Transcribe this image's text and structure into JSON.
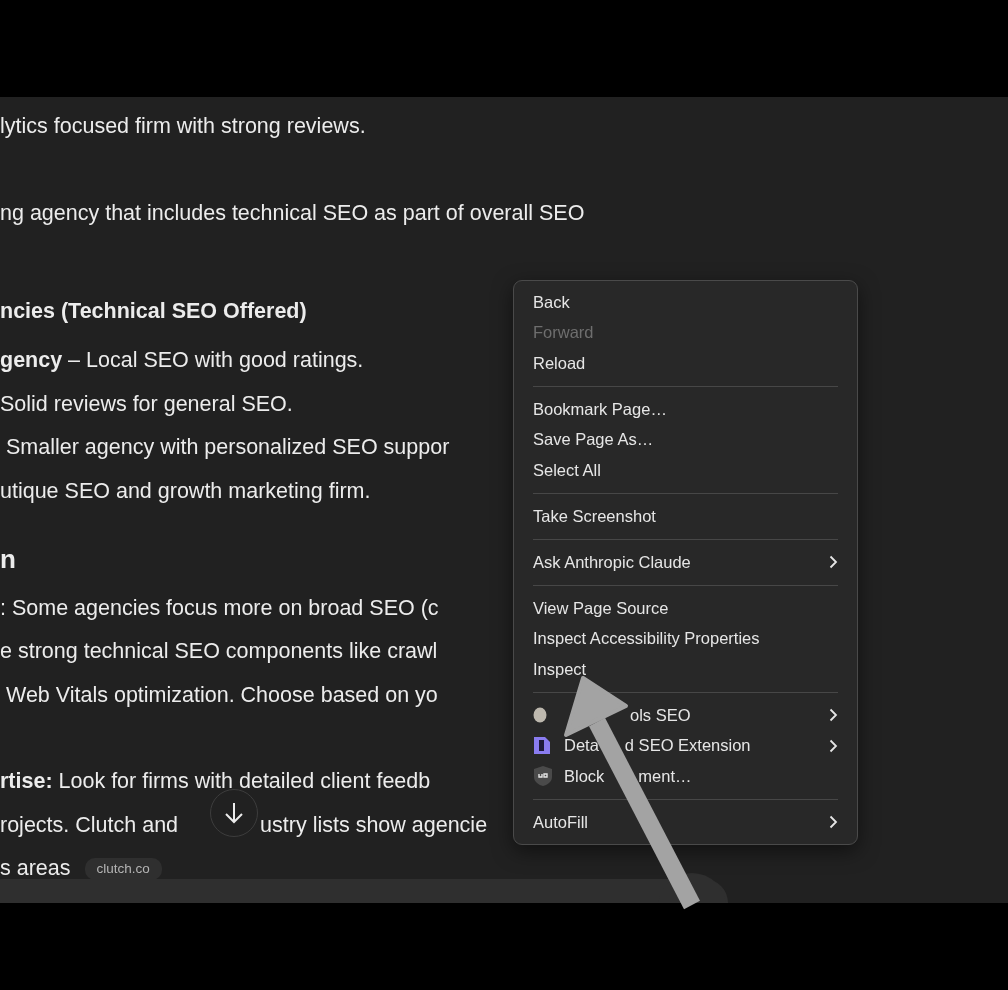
{
  "content": {
    "blocks": [
      {
        "kind": "para",
        "text": "lytics focused firm with strong reviews."
      },
      {
        "kind": "para",
        "text": "ng agency that includes technical SEO as part of overall SEO"
      },
      {
        "kind": "heading",
        "text": "ncies (Technical SEO Offered)"
      },
      {
        "kind": "line",
        "text": "**gency** – Local SEO with good ratings."
      },
      {
        "kind": "line",
        "text": "Solid reviews for general SEO."
      },
      {
        "kind": "line",
        "text": " Smaller agency with personalized SEO suppor"
      },
      {
        "kind": "line",
        "text": "utique SEO and growth marketing firm."
      },
      {
        "kind": "heading_large",
        "text": "n"
      },
      {
        "kind": "line",
        "text": ": Some agencies focus more on broad SEO (c"
      },
      {
        "kind": "line",
        "text": "e strong technical SEO components like crawl"
      },
      {
        "kind": "line",
        "text": " Web Vitals optimization. Choose based on yo"
      },
      {
        "kind": "para",
        "text": "**rtise:** Look for firms with detailed client feedb"
      },
      {
        "kind": "line",
        "text": "rojects. Clutch and",
        "text_after": "ustry lists show agencie"
      },
      {
        "kind": "line",
        "text": "s areas",
        "chip": "clutch.co"
      }
    ]
  },
  "context_menu": {
    "groups": [
      [
        {
          "kind": "plain",
          "label": "Back",
          "disabled": false
        },
        {
          "kind": "plain",
          "label": "Forward",
          "disabled": true
        },
        {
          "kind": "plain",
          "label": "Reload",
          "disabled": false
        }
      ],
      [
        {
          "kind": "plain",
          "label": "Bookmark Page…",
          "disabled": false
        },
        {
          "kind": "plain",
          "label": "Save Page As…",
          "disabled": false
        },
        {
          "kind": "plain",
          "label": "Select All",
          "disabled": false
        }
      ],
      [
        {
          "kind": "plain",
          "label": "Take Screenshot",
          "disabled": false
        }
      ],
      [
        {
          "kind": "submenu",
          "label": "Ask Anthropic Claude",
          "disabled": false
        }
      ],
      [
        {
          "kind": "plain",
          "label": "View Page Source",
          "disabled": false
        },
        {
          "kind": "plain",
          "label": "Inspect Accessibility Properties",
          "disabled": false
        },
        {
          "kind": "plain",
          "label": "Inspect",
          "disabled": false
        }
      ],
      [
        {
          "kind": "extension",
          "parts": [
            "ols SEO"
          ],
          "covered_start": true,
          "submenu": true
        },
        {
          "kind": "extension",
          "parts": [
            "Deta",
            "d SEO Extension"
          ],
          "covered_start": false,
          "submenu": true
        },
        {
          "kind": "extension",
          "parts": [
            "Block",
            "ment…"
          ],
          "covered_start": false,
          "submenu": false
        }
      ],
      [
        {
          "kind": "submenu",
          "label": "AutoFill",
          "disabled": false
        }
      ]
    ]
  }
}
